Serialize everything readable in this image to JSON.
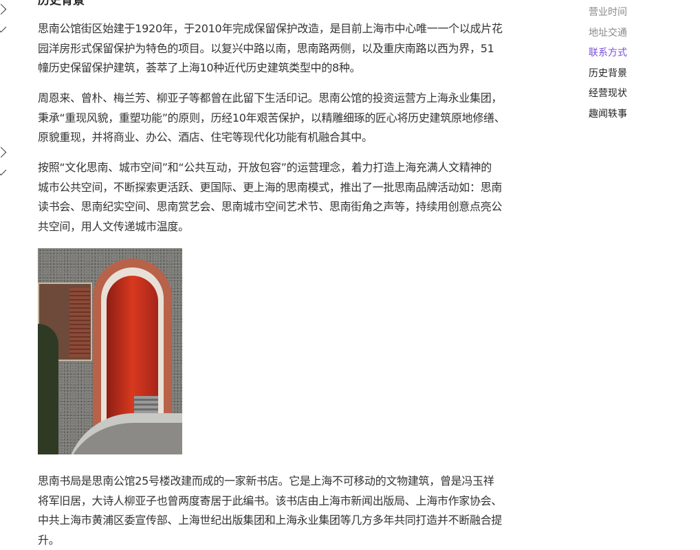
{
  "article": {
    "section_heading": "历史背景",
    "paragraphs": [
      {
        "lines": [
          "思南公馆街区始建于1920年，于2010年完成保留保护改造，是目前上海市中心唯一一个以成片花",
          "园洋房形式保留保护为特色的项目。以复兴中路以南，思南路两侧，以及重庆南路以西为界，51",
          "幢历史保留保护建筑，荟萃了上海10种近代历史建筑类型中的8种。"
        ]
      },
      {
        "lines": [
          "周恩来、曾朴、梅兰芳、柳亚子等都曾在此留下生活印记。思南公馆的投资运营方上海永业集团，",
          "秉承“重现风貌，重塑功能”的原则，历经10年艰苦保护，以精雕细琢的匠心将历史建筑原地修缮、",
          "原貌重现，并将商业、办公、酒店、住宅等现代化功能有机融合其中。"
        ]
      },
      {
        "lines": [
          "按照“文化思南、城市空间”和“公共互动，开放包容”的运营理念，着力打造上海充满人文精神的",
          "城市公共空间，不断探索更活跃、更国际、更上海的思南模式，推出了一批思南品牌活动如：思南",
          "读书会、思南纪实空间、思南赏艺会、思南城市空间艺术节、思南街角之声等，持续用创意点亮公",
          "共空间，用人文传递城市温度。"
        ]
      },
      {
        "lines": [
          "思南书局是思南公馆25号楼改建而成的一家新书店。它是上海不可移动的文物建筑，曾是冯玉祥",
          "将军旧居，大诗人柳亚子也曾两度寄居于此编书。该书店由上海市新闻出版局、上海市作家协会、",
          "中共上海市黄浦区委宣传部、上海世纪出版集团和上海永业集团等几方多年共同打造并不断融合提",
          "升。"
        ]
      }
    ]
  },
  "toc": {
    "items": [
      {
        "label": "营业时间",
        "state": "muted"
      },
      {
        "label": "地址交通",
        "state": "muted"
      },
      {
        "label": "联系方式",
        "state": "active"
      },
      {
        "label": "历史背景",
        "state": "normal"
      },
      {
        "label": "经营现状",
        "state": "normal"
      },
      {
        "label": "趣闻轶事",
        "state": "normal"
      }
    ],
    "active_color": "#7b4fd6"
  }
}
